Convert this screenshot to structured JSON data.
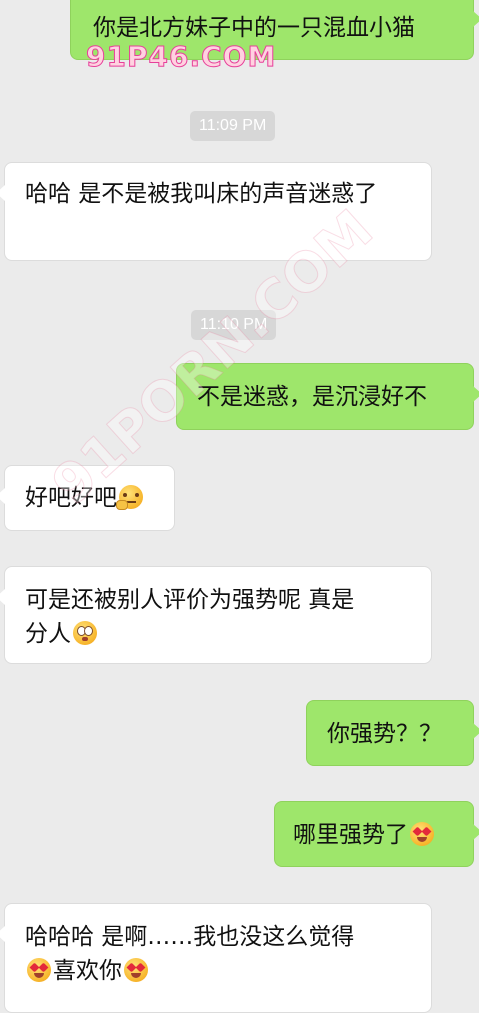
{
  "watermarks": [
    "91P46.COM",
    "91PORN.COM"
  ],
  "messages": [
    {
      "side": "out",
      "text": "你是北方妹子中的一只混血小猫"
    },
    {
      "side": "time",
      "text": "11:09 PM"
    },
    {
      "side": "in",
      "text": "哈哈 是不是被我叫床的声音迷惑了"
    },
    {
      "side": "time",
      "text": "11:10 PM"
    },
    {
      "side": "out",
      "text": "不是迷惑，是沉浸好不"
    },
    {
      "side": "in",
      "text": "好吧好吧",
      "emoji_after": "thinking-face-emoji"
    },
    {
      "side": "in",
      "text_line1": "可是还被别人评价为强势呢 真是",
      "text_line2": "分人",
      "emoji_after": "flushed-face-emoji"
    },
    {
      "side": "out",
      "text": "你强势？？"
    },
    {
      "side": "out",
      "text": "哪里强势了",
      "emoji_after": "heart-eyes-emoji"
    },
    {
      "side": "in",
      "text_line1": "哈哈哈 是啊……我也没这么觉得",
      "text_line2": "喜欢你",
      "emoji_before": "heart-eyes-emoji",
      "emoji_after": "heart-eyes-emoji"
    }
  ],
  "colors": {
    "background": "#ebebeb",
    "outgoing_bubble": "#9ee66b",
    "incoming_bubble": "#ffffff",
    "timestamp_bg": "#d7d7d7"
  }
}
